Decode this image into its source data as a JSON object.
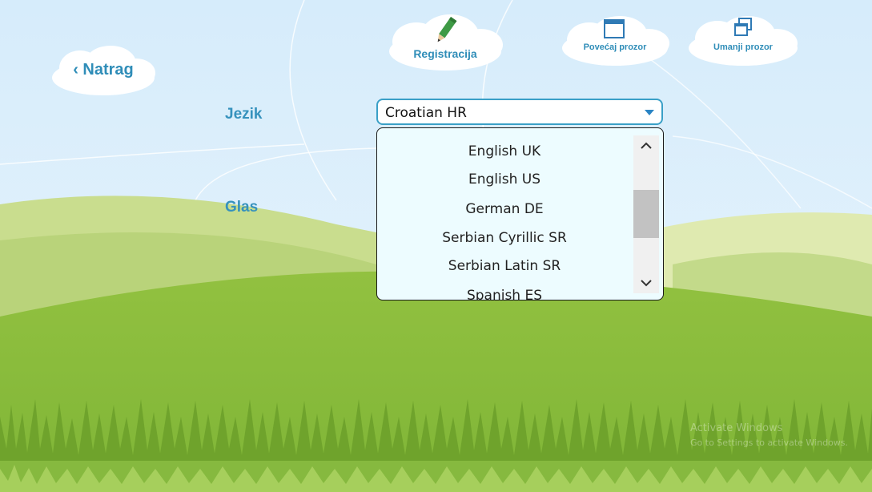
{
  "header": {
    "back_label": "‹ Natrag",
    "register_label": "Registracija",
    "maximize_label": "Povećaj prozor",
    "minimize_label": "Umanji prozor"
  },
  "form": {
    "language_label": "Jezik",
    "voice_label": "Glas",
    "language_selected": "Croatian HR"
  },
  "language_options": [
    "English UK",
    "English US",
    "German DE",
    "Serbian Cyrillic SR",
    "Serbian Latin SR",
    "Spanish ES"
  ],
  "icons": {
    "register": "pencil-icon",
    "maximize": "maximize-window-icon",
    "minimize": "restore-window-icon",
    "dropdown": "chevron-down-icon",
    "scroll_up": "chevron-up-icon",
    "scroll_down": "chevron-down-icon"
  },
  "watermark": {
    "line1": "Activate Windows",
    "line2": "Go to Settings to activate Windows."
  },
  "colors": {
    "sky": "#dceefc",
    "label_blue": "#3692bd",
    "grass_dark": "#7fb43a",
    "grass_light": "#9cc648",
    "combo_border": "#3aa0c7"
  }
}
